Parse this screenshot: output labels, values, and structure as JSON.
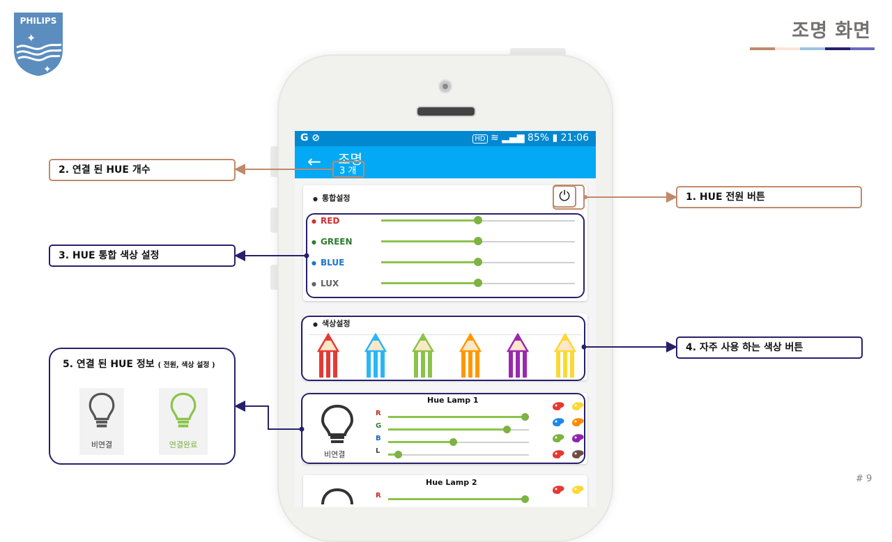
{
  "slide": {
    "logo": "PHILIPS",
    "title": "조명 화면",
    "page_number": "# 9",
    "title_bar_colors": [
      "#c0896c",
      "#fbe5d6",
      "#9dc3e6",
      "#26206b",
      "#6a6ac0"
    ]
  },
  "phone": {
    "statusbar": {
      "left_icons": "G ⊘",
      "hd": "HD",
      "battery": "85%",
      "time": "21:06"
    },
    "appbar": {
      "back": "←",
      "title": "조명",
      "count": "3 개"
    },
    "master": {
      "label": "통합설정",
      "power_icon": "power-icon",
      "sliders": [
        {
          "label": "RED",
          "color": "#d32f2f",
          "value": 0.5
        },
        {
          "label": "GREEN",
          "color": "#2e7d32",
          "value": 0.5
        },
        {
          "label": "BLUE",
          "color": "#1976d2",
          "value": 0.5
        },
        {
          "label": "LUX",
          "color": "#616161",
          "value": 0.5
        }
      ]
    },
    "color_section": {
      "label": "색상설정",
      "pencils": [
        "#e53935",
        "#29b6f6",
        "#8bc34a",
        "#ff9800",
        "#9c27b0",
        "#fdd835"
      ]
    },
    "lamps": [
      {
        "name": "Hue Lamp 1",
        "status": "비연결",
        "sliders": [
          {
            "label": "R",
            "color": "#c62828",
            "value": 0.97
          },
          {
            "label": "G",
            "color": "#2e7d32",
            "value": 0.84
          },
          {
            "label": "B",
            "color": "#1565c0",
            "value": 0.46
          },
          {
            "label": "L",
            "color": "#424242",
            "value": 0.07
          }
        ],
        "palettes": [
          "#e53935",
          "#fdd835",
          "#1e88e5",
          "#fb8c00",
          "#7cb342",
          "#8e24aa",
          "#e53935",
          "#6d4c41"
        ]
      },
      {
        "name": "Hue Lamp 2",
        "sliders": [
          {
            "label": "R",
            "color": "#c62828",
            "value": 0.97
          }
        ],
        "palettes": [
          "#e53935",
          "#fdd835"
        ]
      }
    ]
  },
  "callouts": {
    "c1": "1. HUE 전원 버튼",
    "c2": "2. 연결 된 HUE 개수",
    "c3": "3. HUE 통합 색상 설정",
    "c4": "4. 자주 사용 하는 색상 버튼",
    "c5_title": "5. 연결 된 HUE 정보",
    "c5_small": "( 전원, 색상 설정 )",
    "c5_off_label": "비연결",
    "c5_on_label": "연결완료"
  }
}
